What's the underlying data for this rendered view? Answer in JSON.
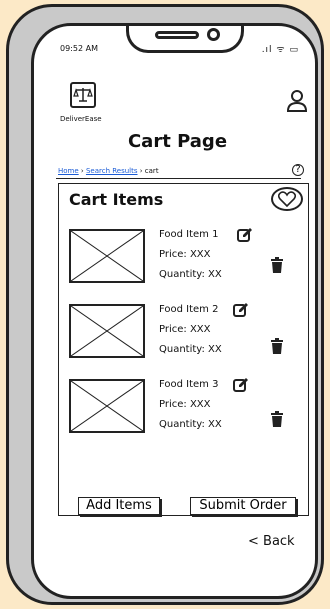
{
  "status_bar": {
    "time": "09:52 AM",
    "icons": ".ıl ᯤ ▭"
  },
  "header": {
    "brand": "DeliverEase",
    "page_title": "Cart Page"
  },
  "breadcrumb": {
    "home": "Home",
    "search": "Search Results",
    "current": "cart",
    "separator": "›"
  },
  "cart": {
    "title": "Cart Items",
    "items": [
      {
        "name": "Food Item 1",
        "price": "Price: XXX",
        "quantity": "Quantity: XX"
      },
      {
        "name": "Food Item 2",
        "price": "Price: XXX",
        "quantity": "Quantity: XX"
      },
      {
        "name": "Food Item 3",
        "price": "Price: XXX",
        "quantity": "Quantity: XX"
      }
    ],
    "add_label": "Add Items",
    "submit_label": "Submit Order"
  },
  "footer": {
    "back_label": "< Back"
  },
  "colors": {
    "background": "#fce9c7",
    "link": "#1a5bd6",
    "frame": "#c9c9c9"
  }
}
